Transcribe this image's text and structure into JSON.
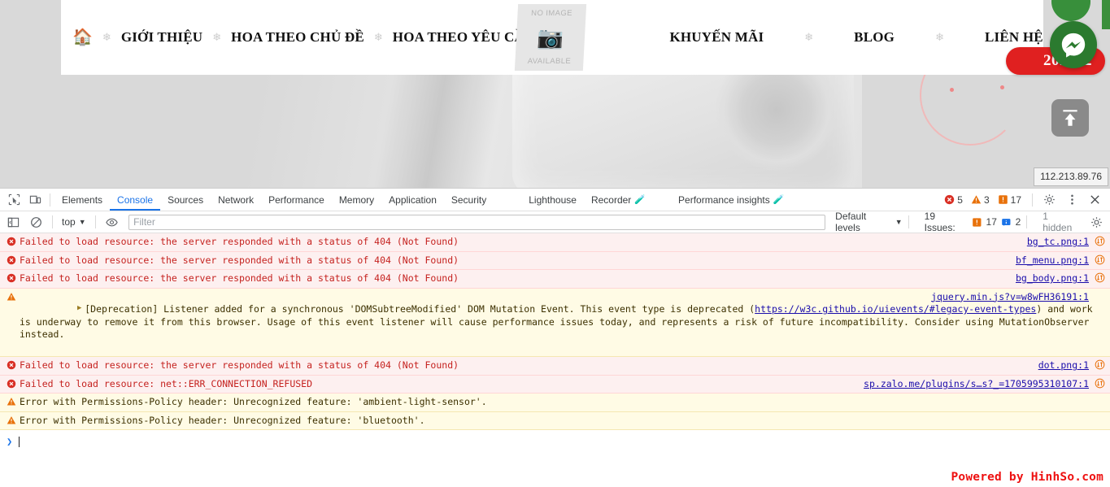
{
  "website": {
    "nav_items": [
      {
        "id": "home",
        "label": "",
        "icon": "home-icon"
      },
      {
        "id": "gioi-thieu",
        "label": "GIỚI THIỆU"
      },
      {
        "id": "hoa-theo-chu-de",
        "label": "HOA THEO CHỦ ĐỀ"
      },
      {
        "id": "hoa-theo-yeu-cau",
        "label": "HOA THEO YÊU CẦU"
      },
      {
        "id": "khuyen-mai",
        "label": "KHUYẾN MÃI"
      },
      {
        "id": "blog",
        "label": "BLOG"
      },
      {
        "id": "lien-he",
        "label": "LIÊN HỆ"
      }
    ],
    "placeholder_image": {
      "line1": "NO IMAGE",
      "line2": "AVAILABLE"
    },
    "phone_badge": "202202",
    "messenger_label": "messenger-icon",
    "scroll_top_label": "scroll-to-top-icon",
    "status_tooltip": "112.213.89.76",
    "footer_credit": "Powered by HinhSo.com",
    "colors": {
      "nav_home_green": "#3e8b3e",
      "messenger_green": "#2b7a2f",
      "phone_red": "#e02020",
      "credit_red": "#ee1111"
    }
  },
  "devtools": {
    "tabs": [
      {
        "id": "elements",
        "label": "Elements",
        "active": false,
        "beaker": false
      },
      {
        "id": "console",
        "label": "Console",
        "active": true,
        "beaker": false
      },
      {
        "id": "sources",
        "label": "Sources",
        "active": false,
        "beaker": false
      },
      {
        "id": "network",
        "label": "Network",
        "active": false,
        "beaker": false
      },
      {
        "id": "performance",
        "label": "Performance",
        "active": false,
        "beaker": false
      },
      {
        "id": "memory",
        "label": "Memory",
        "active": false,
        "beaker": false
      },
      {
        "id": "application",
        "label": "Application",
        "active": false,
        "beaker": false
      },
      {
        "id": "security",
        "label": "Security",
        "active": false,
        "beaker": false
      },
      {
        "id": "lighthouse",
        "label": "Lighthouse",
        "active": false,
        "beaker": false
      },
      {
        "id": "recorder",
        "label": "Recorder",
        "active": false,
        "beaker": true
      },
      {
        "id": "performance-insights",
        "label": "Performance insights",
        "active": false,
        "beaker": true
      }
    ],
    "counters": {
      "errors": "5",
      "warnings": "3",
      "issues": "17"
    },
    "toolbar": {
      "context_value": "top",
      "filter_placeholder": "Filter",
      "filter_value": "",
      "levels_label": "Default levels",
      "issues_label": "19 Issues:",
      "issues_error_count": "17",
      "issues_info_count": "2",
      "hidden_label": "1 hidden"
    },
    "messages": [
      {
        "id": "m1",
        "level": "error",
        "text": "Failed to load resource: the server responded with a status of 404 (Not Found)",
        "source": "bg_tc.png:1",
        "has_network_icon": true
      },
      {
        "id": "m2",
        "level": "error",
        "text": "Failed to load resource: the server responded with a status of 404 (Not Found)",
        "source": "bf_menu.png:1",
        "has_network_icon": true
      },
      {
        "id": "m3",
        "level": "error",
        "text": "Failed to load resource: the server responded with a status of 404 (Not Found)",
        "source": "bg_body.png:1",
        "has_network_icon": true
      },
      {
        "id": "m4",
        "level": "warn",
        "expandable": true,
        "text_part1": "[Deprecation] Listener added for a synchronous 'DOMSubtreeModified' DOM Mutation Event. This event type is deprecated (",
        "link_text": "https://w3c.github.io/uievents/#legacy-event-types",
        "text_part2": ") and work is underway to remove it from this browser. Usage of this event listener will cause performance issues today, and represents a risk of future incompatibility. Consider using MutationObserver instead.",
        "source": "jquery.min.js?v=w8wFH36191:1",
        "has_network_icon": false
      },
      {
        "id": "m5",
        "level": "error",
        "text": "Failed to load resource: the server responded with a status of 404 (Not Found)",
        "source": "dot.png:1",
        "has_network_icon": true
      },
      {
        "id": "m6",
        "level": "error",
        "text": "Failed to load resource: net::ERR_CONNECTION_REFUSED",
        "source": "sp.zalo.me/plugins/s…s?_=1705995310107:1",
        "has_network_icon": true
      },
      {
        "id": "m7",
        "level": "warn",
        "text": "Error with Permissions-Policy header: Unrecognized feature: 'ambient-light-sensor'.",
        "source": "",
        "has_network_icon": false
      },
      {
        "id": "m8",
        "level": "warn",
        "text": "Error with Permissions-Policy header: Unrecognized feature: 'bluetooth'.",
        "source": "",
        "has_network_icon": false
      }
    ]
  }
}
